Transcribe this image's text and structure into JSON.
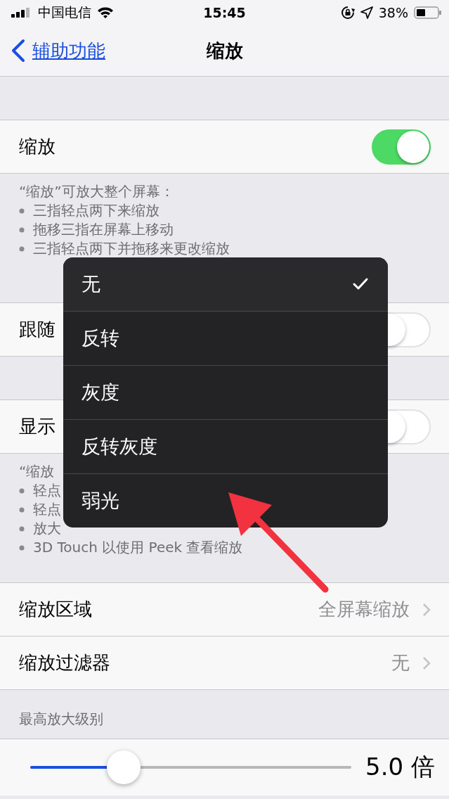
{
  "status_bar": {
    "carrier": "中国电信",
    "time": "15:45",
    "battery": "38%"
  },
  "nav": {
    "back": "辅助功能",
    "title": "缩放"
  },
  "groups": [
    {
      "rows": [
        {
          "kind": "toggle",
          "label": "缩放",
          "on": true
        }
      ],
      "footer": {
        "title": "“缩放”可放大整个屏幕：",
        "bullets": [
          "三指轻点两下来缩放",
          "拖移三指在屏幕上移动",
          "三指轻点两下并拖移来更改缩放"
        ]
      }
    },
    {
      "rows": [
        {
          "kind": "toggle",
          "label": "跟随",
          "on": false
        }
      ]
    },
    {
      "rows": [
        {
          "kind": "toggle",
          "label": "显示",
          "on": false
        }
      ],
      "footer": {
        "title": "“缩放",
        "bullets": [
          "轻点",
          "轻点",
          "放大",
          "3D Touch 以使用 Peek 查看缩放"
        ]
      }
    },
    {
      "rows": [
        {
          "kind": "detail",
          "label": "缩放区域",
          "value": "全屏幕缩放"
        },
        {
          "kind": "detail",
          "label": "缩放过滤器",
          "value": "无"
        }
      ]
    }
  ],
  "slider_header": "最高放大级别",
  "slider": {
    "level": 0.29,
    "reading": "5.0 倍"
  },
  "menu": [
    {
      "label": "无",
      "selected": true
    },
    {
      "label": "反转",
      "selected": false
    },
    {
      "label": "灰度",
      "selected": false
    },
    {
      "label": "反转灰度",
      "selected": false
    },
    {
      "label": "弱光",
      "selected": false
    }
  ]
}
